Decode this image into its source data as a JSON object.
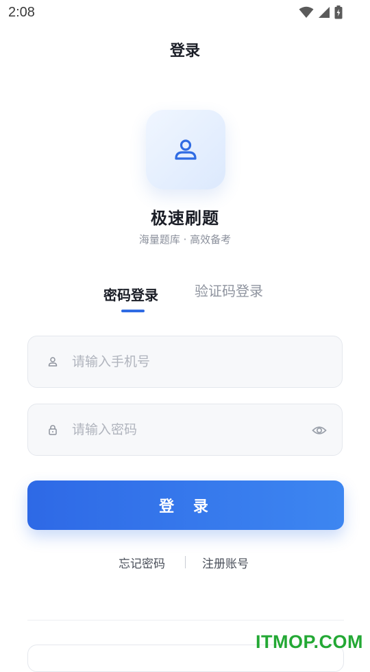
{
  "status_bar": {
    "time": "2:08"
  },
  "header": {
    "title": "登录"
  },
  "app": {
    "name": "极速刷题",
    "slogan": "海量题库 · 高效备考"
  },
  "tabs": [
    {
      "label": "密码登录",
      "active": true
    },
    {
      "label": "验证码登录",
      "active": false
    }
  ],
  "form": {
    "phone": {
      "placeholder": "请输入手机号",
      "value": ""
    },
    "password": {
      "placeholder": "请输入密码",
      "value": ""
    },
    "submit_label": "登 录"
  },
  "links": {
    "forgot": "忘记密码",
    "register": "注册账号"
  },
  "watermark": "ITMOP.COM",
  "colors": {
    "accent": "#2f6be3",
    "button_start": "#2e69e6",
    "button_end": "#3d86f1",
    "watermark": "#23a834"
  },
  "icons": {
    "logo": "user-icon",
    "phone_field": "user-icon",
    "password_field": "lock-icon",
    "password_toggle": "eye-icon"
  }
}
